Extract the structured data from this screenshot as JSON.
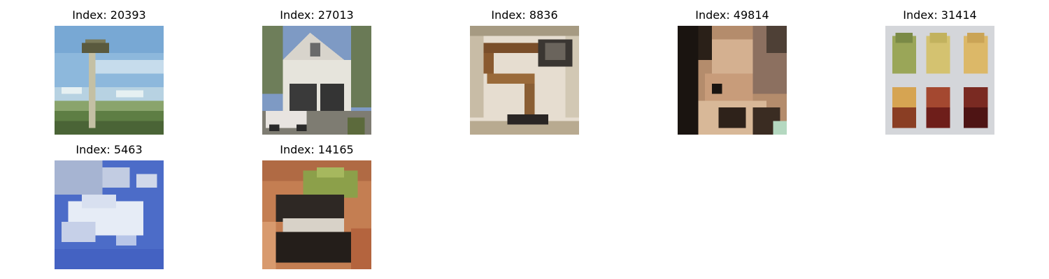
{
  "images": [
    {
      "title": "Index: 20393",
      "subject": "bird-nest-on-pole"
    },
    {
      "title": "Index: 27013",
      "subject": "house-with-garage"
    },
    {
      "title": "Index: 8836",
      "subject": "desk-lamp"
    },
    {
      "title": "Index: 49814",
      "subject": "squirrel"
    },
    {
      "title": "Index: 31414",
      "subject": "pears"
    },
    {
      "title": "Index: 5463",
      "subject": "clouds-in-sky"
    },
    {
      "title": "Index: 14165",
      "subject": "skunk"
    }
  ]
}
